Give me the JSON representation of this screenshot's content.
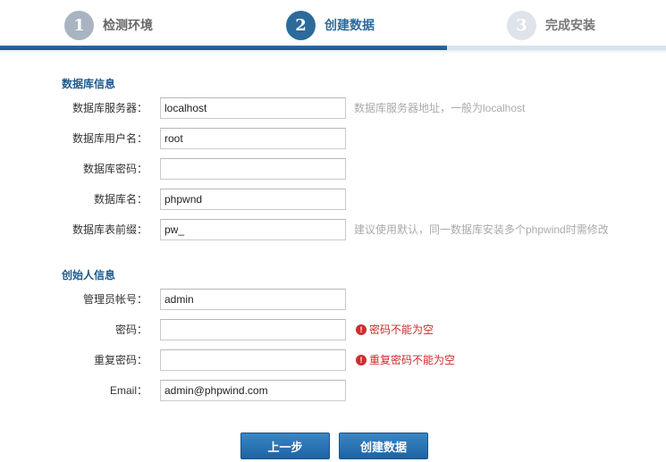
{
  "steps": [
    {
      "number": "1",
      "label": "检测环境",
      "state": "done"
    },
    {
      "number": "2",
      "label": "创建数据",
      "state": "active"
    },
    {
      "number": "3",
      "label": "完成安装",
      "state": "todo"
    }
  ],
  "database_section": {
    "title": "数据库信息",
    "fields": [
      {
        "label": "数据库服务器：",
        "value": "localhost",
        "hint": "数据库服务器地址，一般为localhost"
      },
      {
        "label": "数据库用户名：",
        "value": "root"
      },
      {
        "label": "数据库密码：",
        "value": ""
      },
      {
        "label": "数据库名：",
        "value": "phpwnd"
      },
      {
        "label": "数据库表前缀：",
        "value": "pw_",
        "hint": "建议使用默认，同一数据库安装多个phpwind时需修改"
      }
    ]
  },
  "founder_section": {
    "title": "创始人信息",
    "fields": [
      {
        "label": "管理员帐号：",
        "value": "admin"
      },
      {
        "label": "密码：",
        "value": "",
        "error": "密码不能为空"
      },
      {
        "label": "重复密码：",
        "value": "",
        "error": "重复密码不能为空"
      },
      {
        "label": "Email：",
        "value": "admin@phpwind.com"
      }
    ]
  },
  "buttons": {
    "prev_label": "上一步",
    "create_label": "创建数据"
  },
  "colors": {
    "accent": "#2c6a9c",
    "error": "#cc2b2b",
    "hint": "#aaaaaa"
  }
}
